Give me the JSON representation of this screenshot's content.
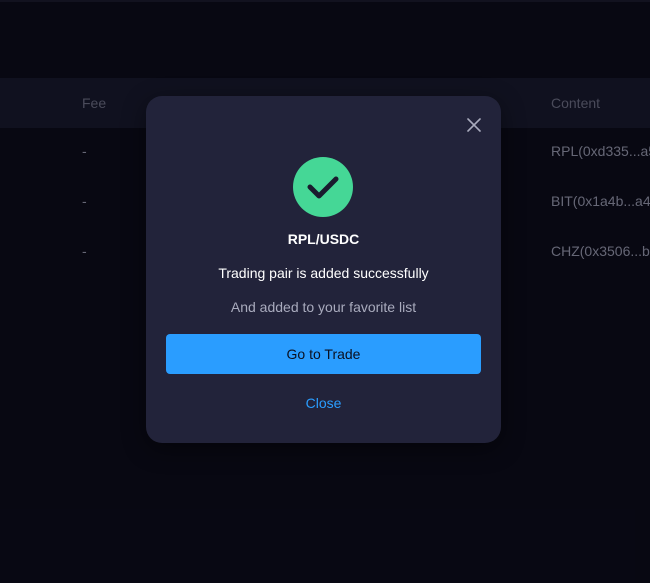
{
  "table": {
    "headers": {
      "fee": "Fee",
      "content": "Content"
    },
    "rows": [
      {
        "fee": "-",
        "content": "RPL(0xd335...a5"
      },
      {
        "fee": "-",
        "content": "BIT(0x1a4b...a4"
      },
      {
        "fee": "-",
        "content": "CHZ(0x3506...b"
      }
    ]
  },
  "modal": {
    "close_icon": "close-icon",
    "success_icon": "checkmark-circle-icon",
    "pair": "RPL/USDC",
    "message": "Trading pair is added successfully",
    "sub_message": "And added to your favorite list",
    "primary_button": "Go to Trade",
    "close_link": "Close"
  },
  "colors": {
    "background": "#0a0a16",
    "modal_bg": "#22233a",
    "success_green": "#45d796",
    "accent_blue": "#2a9dff"
  }
}
